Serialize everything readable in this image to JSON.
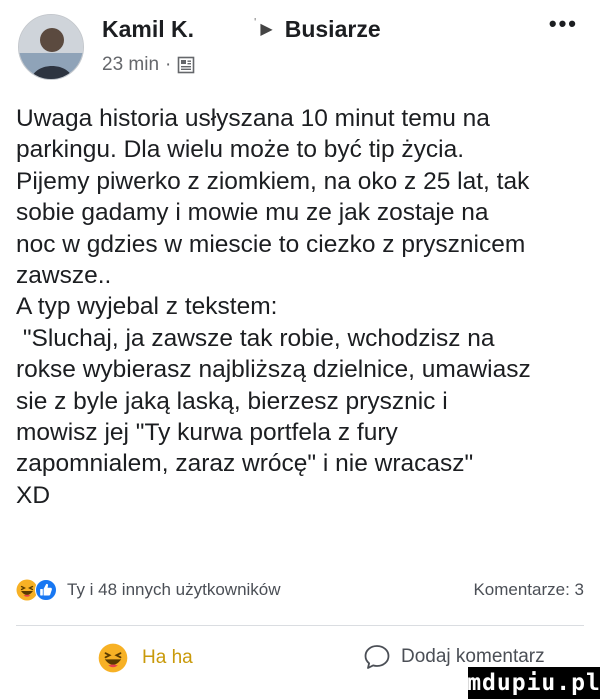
{
  "post": {
    "author": "Kamil K.",
    "group_arrow": "▶",
    "group": "Busiarze",
    "time": "23 min",
    "separator": "·",
    "more_icon": "•••",
    "icons": {
      "avatar": "avatar-photo",
      "privacy": "newspaper-icon",
      "more": "more-options-icon"
    },
    "text": "Uwaga historia usłyszana 10 minut temu na\nparkingu. Dla wielu może to być tip życia.\nPijemy piwerko z ziomkiem, na oko z 25 lat, tak\nsobie gadamy i mowie mu ze jak zostaje na\nnoc w gdzies w miescie to ciezko z prysznicem\nzawsze..\nA typ wyjebal z tekstem:\n \"Sluchaj, ja zawsze tak robie, wchodzisz na\nrokse wybierasz najbliższą dzielnice, umawiasz\nsie z byle jaką laską, bierzesz prysznic i\nmowisz jej \"Ty kurwa portfela z fury\nzapomnialem, zaraz wrócę\" i nie wracasz\"\nXD"
  },
  "reactions": {
    "icons": [
      "haha-reaction-icon",
      "like-reaction-icon"
    ],
    "text": "Ty i 48 innych użytkowników",
    "comments": "Komentarze: 3"
  },
  "actions": {
    "haha_label": "Ha ha",
    "comment_label": "Dodaj komentarz"
  },
  "watermark": "mdupiu.pl",
  "colors": {
    "text": "#1c1e21",
    "secondary": "#65676b",
    "haha": "#f7b125",
    "haha_label": "#c99a0a",
    "like": "#1877f2",
    "divider": "#dadde1"
  }
}
